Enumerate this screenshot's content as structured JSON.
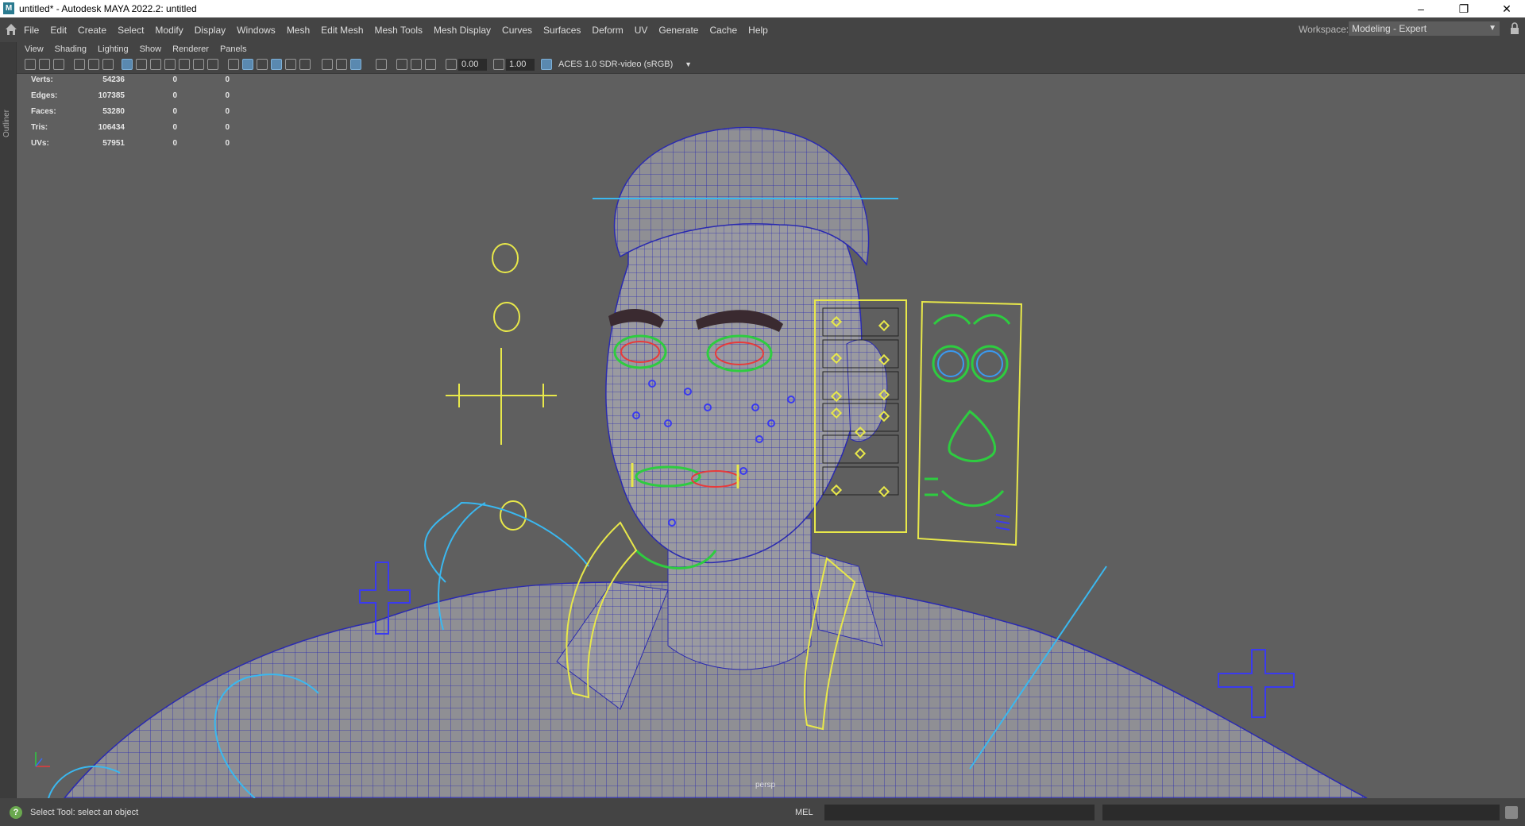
{
  "titlebar": {
    "title": "untitled* - Autodesk MAYA 2022.2: untitled",
    "app_icon": "M",
    "minimize": "–",
    "maximize": "❐",
    "close": "✕"
  },
  "menubar": {
    "items": [
      "File",
      "Edit",
      "Create",
      "Select",
      "Modify",
      "Display",
      "Windows",
      "Mesh",
      "Edit Mesh",
      "Mesh Tools",
      "Mesh Display",
      "Curves",
      "Surfaces",
      "Deform",
      "UV",
      "Generate",
      "Cache",
      "Help"
    ],
    "workspace_label": "Workspace:",
    "workspace_value": "Modeling - Expert"
  },
  "outliner_tab": "Outliner",
  "panel_menu": [
    "View",
    "Shading",
    "Lighting",
    "Show",
    "Renderer",
    "Panels"
  ],
  "panel_toolbar": {
    "field_1": "0.00",
    "field_2": "1.00",
    "color_space": "ACES 1.0 SDR-video (sRGB)"
  },
  "hud": {
    "rows": [
      {
        "label": "Verts:",
        "v1": "54236",
        "v2": "0",
        "v3": "0"
      },
      {
        "label": "Edges:",
        "v1": "107385",
        "v2": "0",
        "v3": "0"
      },
      {
        "label": "Faces:",
        "v1": "53280",
        "v2": "0",
        "v3": "0"
      },
      {
        "label": "Tris:",
        "v1": "106434",
        "v2": "0",
        "v3": "0"
      },
      {
        "label": "UVs:",
        "v1": "57951",
        "v2": "0",
        "v3": "0"
      }
    ]
  },
  "camera_label": "persp",
  "statusbar": {
    "help_text": "Select Tool: select an object",
    "mel_label": "MEL"
  },
  "colors": {
    "wire": "#2a2ab0",
    "control_yellow": "#e8e84a",
    "control_green": "#2ecc40",
    "control_cyan": "#3ab8f0",
    "control_blue": "#3a3af0",
    "control_red": "#e83a3a"
  }
}
